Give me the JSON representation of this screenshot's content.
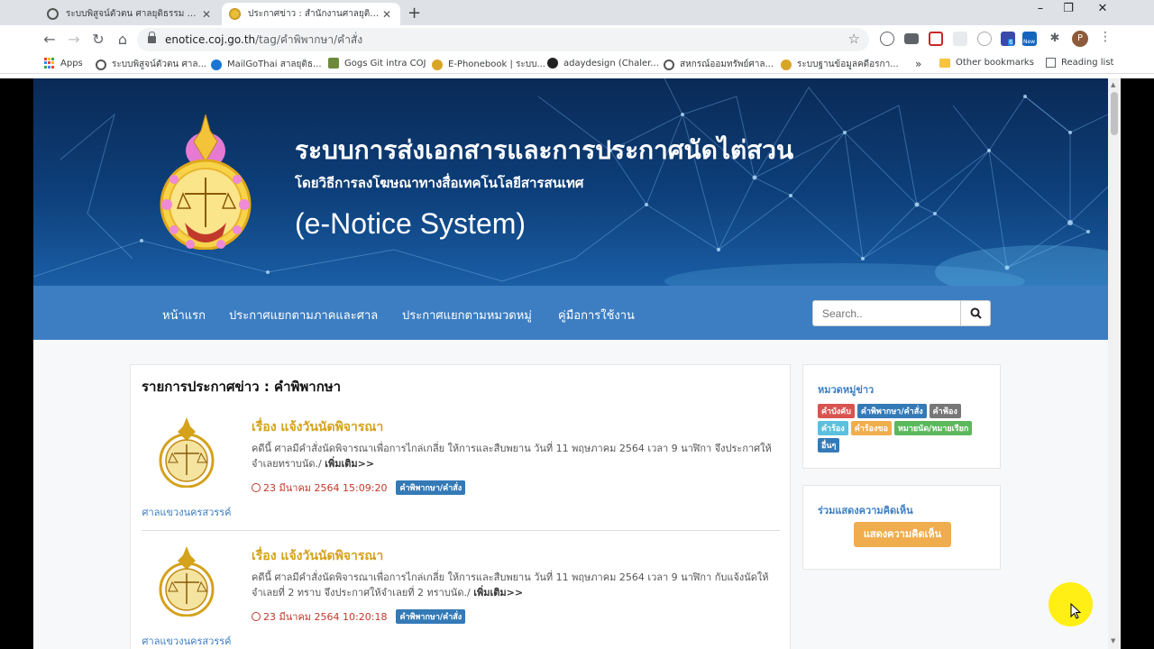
{
  "browser": {
    "tabs": [
      {
        "title": "ระบบพิสูจน์ตัวตน ศาลยุติธรรม Authen",
        "active": false
      },
      {
        "title": "ประกาศข่าว : สำนักงานศาลยุติธรรม",
        "active": true
      }
    ],
    "url_host": "enotice.coj.go.th",
    "url_path": "/tag/คำพิพากษา/คำสั่ง",
    "avatar_letter": "P",
    "ext_badge_new": "New",
    "ext_badge_count": "6",
    "bookmarks": [
      {
        "label": "Apps",
        "icon": "apps-grid-icon"
      },
      {
        "label": "ระบบพิสูจน์ตัวตน ศาล...",
        "icon": "globe-icon"
      },
      {
        "label": "MailGoThai สาลยุติธ...",
        "icon": "mailgothai-icon"
      },
      {
        "label": "Gogs Git intra COJ",
        "icon": "gogs-icon"
      },
      {
        "label": "E-Phonebook | ระบบ...",
        "icon": "coj-icon"
      },
      {
        "label": "adaydesign (Chaler...",
        "icon": "github-icon"
      },
      {
        "label": "สหกรณ์ออมทรัพย์ศาล...",
        "icon": "globe-icon"
      },
      {
        "label": "ระบบฐานข้อมูลคดีอรกา...",
        "icon": "coj-icon"
      }
    ],
    "bookmarks_overflow": "»",
    "other_bookmarks": "Other bookmarks",
    "reading_list": "Reading list"
  },
  "banner": {
    "title": "ระบบการส่งเอกสารและการประกาศนัดไต่สวน",
    "subtitle": "โดยวิธีการลงโฆษณาทางสื่อเทคโนโลยีสารสนเทศ",
    "system_name": "(e-Notice System)"
  },
  "nav": {
    "links": [
      "หน้าแรก",
      "ประกาศแยกตามภาคและศาล",
      "ประกาศแยกตามหมวดหมู่",
      "คู่มือการใช้งาน"
    ],
    "search_placeholder": "Search.."
  },
  "main": {
    "heading": "รายการประกาศข่าว : คำพิพากษา",
    "items": [
      {
        "title": "เรื่อง แจ้งวันนัดพิจารณา",
        "body": "คดีนี้ ศาลมีคำสั่งนัดพิจารณาเพื่อการไกล่เกลี่ย ให้การและสืบพยาน วันที่ 11 พฤษภาคม 2564 เวลา 9 นาฬิกา จึงประกาศให้จำเลยทราบนัด./ ",
        "more": "เพิ่มเติม>>",
        "datetime": "23 มีนาคม 2564 15:09:20",
        "tag": "คำพิพากษา/คำสั่ง",
        "court": "ศาลแขวงนครสวรรค์"
      },
      {
        "title": "เรื่อง แจ้งวันนัดพิจารณา",
        "body": "คดีนี้ ศาลมีคำสั่งนัดพิจารณาเพื่อการไกล่เกลี่ย ให้การและสืบพยาน วันที่ 11 พฤษภาคม 2564 เวลา 9 นาฬิกา กับแจ้งนัดให้จำเลยที่ 2 ทราบ จึงประกาศให้จำเลยที่ 2 ทราบนัด./ ",
        "more": "เพิ่มเติม>>",
        "datetime": "23 มีนาคม 2564 10:20:18",
        "tag": "คำพิพากษา/คำสั่ง",
        "court": "ศาลแขวงนครสวรรค์"
      }
    ]
  },
  "sidebar": {
    "categories_title": "หมวดหมู่ข่าว",
    "tags": [
      {
        "label": "คำบังคับ",
        "color": "#d9534f"
      },
      {
        "label": "คำพิพากษา/คำสั่ง",
        "color": "#337ab7"
      },
      {
        "label": "คำฟ้อง",
        "color": "#777777"
      },
      {
        "label": "คำร้อง",
        "color": "#5bc0de"
      },
      {
        "label": "คำร้องขอ",
        "color": "#f0ad4e"
      },
      {
        "label": "หมายนัด/หมายเรียก",
        "color": "#5cb85c"
      },
      {
        "label": "อื่นๆ",
        "color": "#337ab7"
      }
    ],
    "comment_title": "ร่วมแสดงความคิดเห็น",
    "comment_button": "แสดงความคิดเห็น"
  },
  "colors": {
    "nav_blue": "#3d7ec2",
    "title_gold": "#d4a21b",
    "date_red": "#c0392b",
    "button_orange": "#f0ad4e"
  }
}
